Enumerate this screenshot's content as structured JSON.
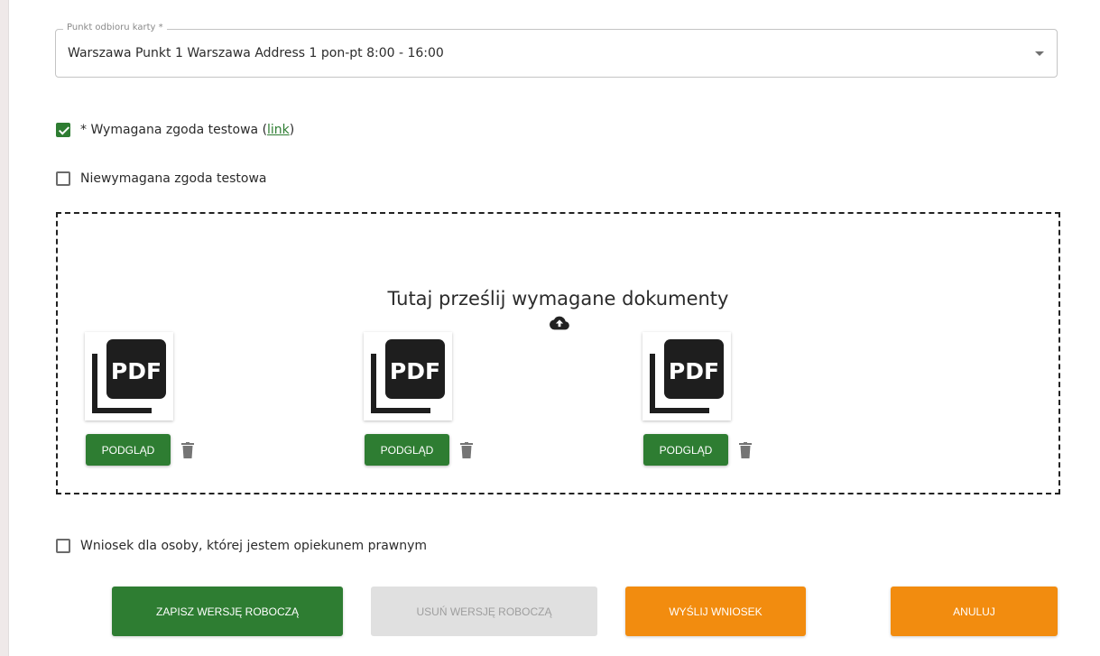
{
  "pickup": {
    "legend": "Punkt odbioru karty *",
    "value": "Warszawa Punkt 1 Warszawa Address 1 pon-pt 8:00 - 16:00"
  },
  "consents": {
    "required": {
      "label": "* Wymagana zgoda testowa (",
      "link": "link",
      "label_end": ")",
      "checked": true
    },
    "optional": {
      "label": "Niewymagana zgoda testowa",
      "checked": false
    },
    "guardian": {
      "label": "Wniosek dla osoby, której jestem opiekunem prawnym",
      "checked": false
    }
  },
  "upload": {
    "title": "Tutaj prześlij wymagane dokumenty",
    "upload_icon": "cloud-upload-icon",
    "documents": [
      {
        "type": "PDF",
        "preview_label": "PODGLĄD",
        "delete_icon": "trash-icon"
      },
      {
        "type": "PDF",
        "preview_label": "PODGLĄD",
        "delete_icon": "trash-icon"
      },
      {
        "type": "PDF",
        "preview_label": "PODGLĄD",
        "delete_icon": "trash-icon"
      }
    ]
  },
  "actions": {
    "save_draft": "ZAPISZ WERSJĘ ROBOCZĄ",
    "delete_draft": "USUŃ WERSJĘ ROBOCZĄ",
    "submit": "WYŚLIJ WNIOSEK",
    "cancel": "ANULUJ"
  },
  "colors": {
    "primary_green": "#2e7d32",
    "accent_orange": "#f28c0f",
    "disabled_gray": "#e0e0e0"
  }
}
